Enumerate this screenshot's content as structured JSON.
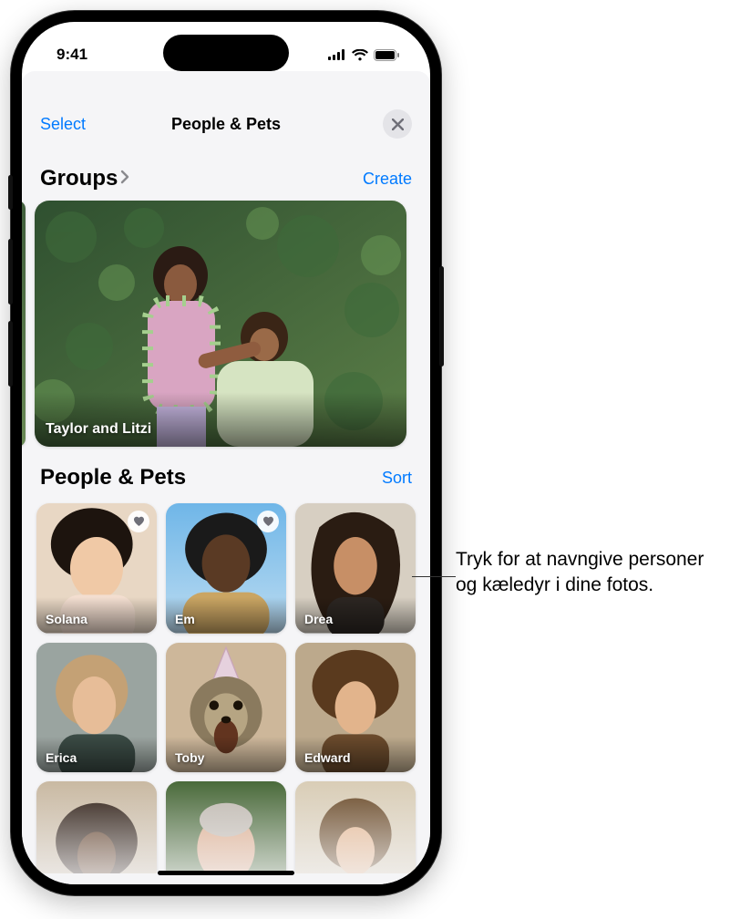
{
  "status": {
    "time": "9:41"
  },
  "nav": {
    "select": "Select",
    "title": "People & Pets"
  },
  "sections": {
    "groups": {
      "title": "Groups",
      "action": "Create",
      "cards": [
        {
          "name": "Taylor and Litzi"
        }
      ]
    },
    "people": {
      "title": "People & Pets",
      "action": "Sort",
      "tiles": [
        {
          "name": "Solana",
          "favorite": true
        },
        {
          "name": "Em",
          "favorite": true
        },
        {
          "name": "Drea",
          "favorite": false
        },
        {
          "name": "Erica",
          "favorite": false
        },
        {
          "name": "Toby",
          "favorite": false
        },
        {
          "name": "Edward",
          "favorite": false
        }
      ]
    }
  },
  "callout": "Tryk for at navngive personer og kæledyr i dine fotos."
}
